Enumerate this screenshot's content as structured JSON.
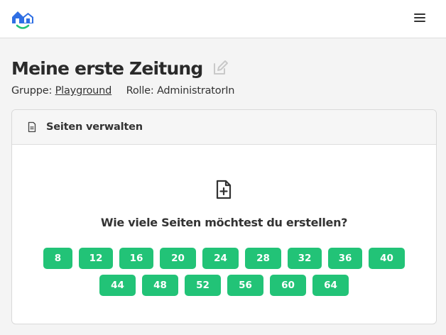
{
  "header": {
    "logo_icon": "house-smile-logo",
    "menu_icon": "hamburger-icon"
  },
  "page": {
    "title": "Meine erste Zeitung",
    "edit_icon": "pencil-square-icon",
    "group_label": "Gruppe:",
    "group_link": "Playground",
    "role_text": "Rolle: AdministratorIn"
  },
  "panel": {
    "header_icon": "document-icon",
    "header_title": "Seiten verwalten",
    "add_icon": "file-plus-icon",
    "question": "Wie viele Seiten möchtest du erstellen?",
    "page_options_row1": [
      "8",
      "12",
      "16",
      "20",
      "24",
      "28",
      "32",
      "36",
      "40"
    ],
    "page_options_row2": [
      "44",
      "48",
      "52",
      "56",
      "60",
      "64"
    ]
  },
  "colors": {
    "accent": "#22c377",
    "logo_blue": "#2f6fe4",
    "logo_green": "#22c377"
  }
}
